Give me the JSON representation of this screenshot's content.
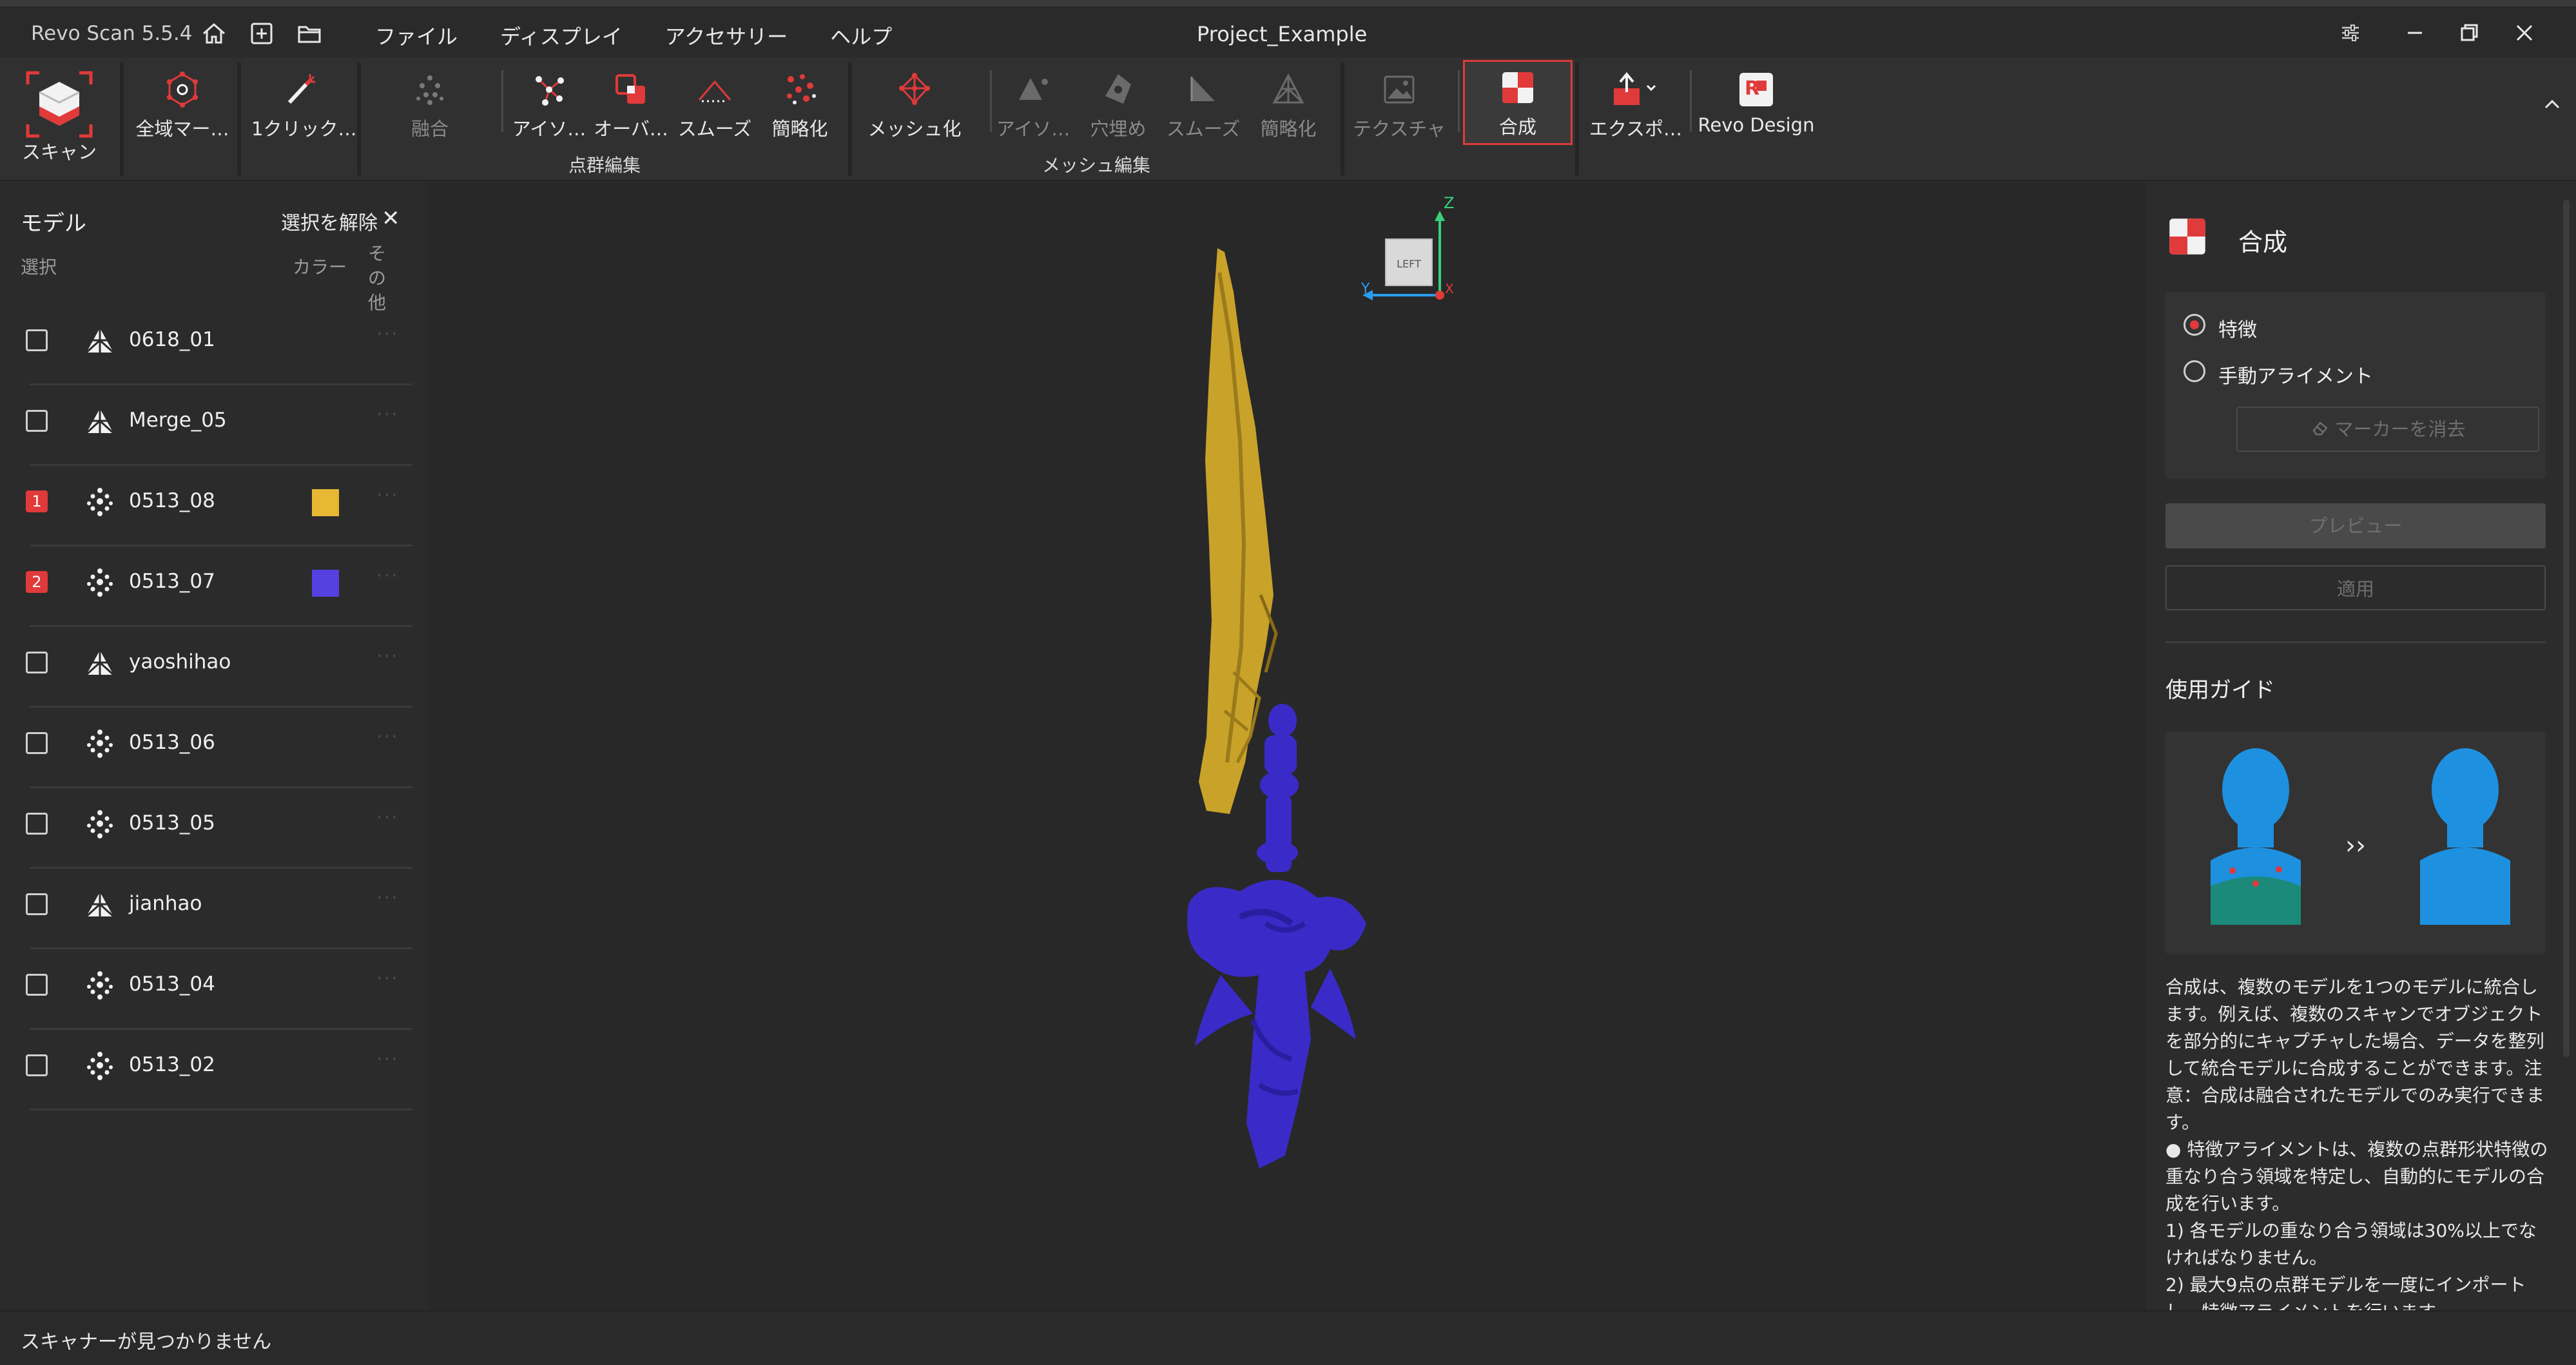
{
  "titlebar": {
    "app_name": "Revo Scan 5.5.4",
    "doc_title": "Project_Example",
    "menus": [
      "ファイル",
      "ディスプレイ",
      "アクセサリー",
      "ヘルプ"
    ]
  },
  "ribbon": {
    "scan": "スキャン",
    "global_marker": "全域マー…",
    "one_click": "1クリック…",
    "pc_fuse": "融合",
    "pc_isolate": "アイソ…",
    "pc_overlap": "オーバ…",
    "pc_smooth": "スムーズ",
    "pc_simplify": "簡略化",
    "pc_group_label": "点群編集",
    "mesh": "メッシュ化",
    "mesh_isolate": "アイソ…",
    "mesh_fill": "穴埋め",
    "mesh_smooth": "スムーズ",
    "mesh_simplify": "簡略化",
    "mesh_group_label": "メッシュ編集",
    "texture": "テクスチャ",
    "merge": "合成",
    "export": "エクスポ…",
    "revo_design": "Revo Design"
  },
  "left_panel": {
    "title": "モデル",
    "deselect": "選択を解除",
    "col_select": "選択",
    "col_color": "カラー",
    "col_other": "その他",
    "models": [
      {
        "name": "0618_01",
        "type": "mesh",
        "selected": "",
        "color": ""
      },
      {
        "name": "Merge_05",
        "type": "mesh",
        "selected": "",
        "color": ""
      },
      {
        "name": "0513_08",
        "type": "points",
        "selected": "1",
        "color": "#e7b834"
      },
      {
        "name": "0513_07",
        "type": "points",
        "selected": "2",
        "color": "#5540e0"
      },
      {
        "name": "yaoshihao",
        "type": "mesh",
        "selected": "",
        "color": ""
      },
      {
        "name": "0513_06",
        "type": "points",
        "selected": "",
        "color": ""
      },
      {
        "name": "0513_05",
        "type": "points",
        "selected": "",
        "color": ""
      },
      {
        "name": "jianhao",
        "type": "mesh",
        "selected": "",
        "color": ""
      },
      {
        "name": "0513_04",
        "type": "points",
        "selected": "",
        "color": ""
      },
      {
        "name": "0513_02",
        "type": "points",
        "selected": "",
        "color": ""
      }
    ]
  },
  "viewport": {
    "cube_face": "LEFT",
    "axis_z": "Z",
    "axis_y": "Y",
    "axis_x": "X"
  },
  "right_panel": {
    "title": "合成",
    "option_feature": "特徴",
    "option_manual": "手動アライメント",
    "clear_markers": "マーカーを消去",
    "preview": "プレビュー",
    "apply": "適用",
    "guide_title": "使用ガイド",
    "guide_text": "合成は、複数のモデルを1つのモデルに統合します。例えば、複数のスキャンでオブジェクトを部分的にキャプチャした場合、データを整列して統合モデルに合成することができます。注意：合成は融合されたモデルでのみ実行できます。\n● 特徴アライメントは、複数の点群形状特徴の重なり合う領域を特定し、自動的にモデルの合成を行います。\n1) 各モデルの重なり合う領域は30%以上でなければなりません。\n2) 最大9点の点群モデルを一度にインポートし、特徴アライメントを行います。"
  },
  "status": {
    "text": "スキャナーが見つかりません"
  },
  "colors": {
    "accent": "#e03a3a",
    "gold_model": "#c9a22a",
    "blue_model": "#3a2bc8",
    "bust_blue": "#1e90e0"
  }
}
